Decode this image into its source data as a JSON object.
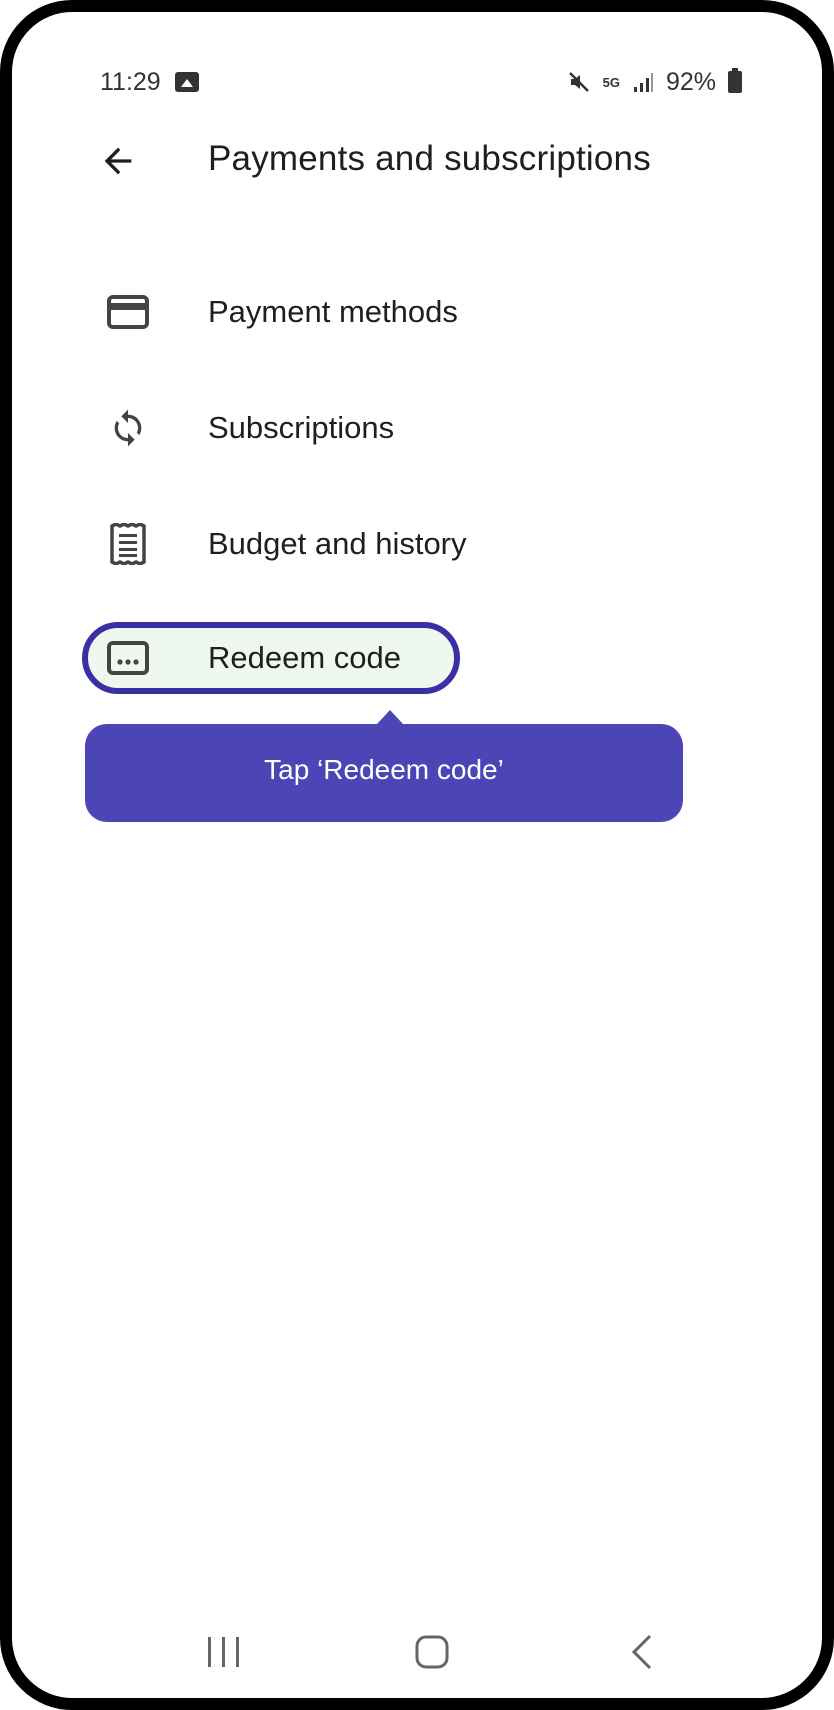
{
  "status_bar": {
    "time": "11:29",
    "battery": "92%",
    "network": "5G"
  },
  "appbar": {
    "title": "Payments and subscriptions",
    "back_icon": "arrow-back-icon"
  },
  "menu": [
    {
      "label": "Payment methods",
      "icon": "credit-card-icon"
    },
    {
      "label": "Subscriptions",
      "icon": "sync-icon"
    },
    {
      "label": "Budget and history",
      "icon": "receipt-icon"
    },
    {
      "label": "Redeem code",
      "icon": "redeem-code-icon"
    }
  ],
  "tooltip": {
    "text": "Tap ‘Redeem code’"
  },
  "colors": {
    "highlight_border": "#3a2fa5",
    "tooltip_bg": "#4b45b5",
    "highlight_bg": "#eef8ee"
  }
}
